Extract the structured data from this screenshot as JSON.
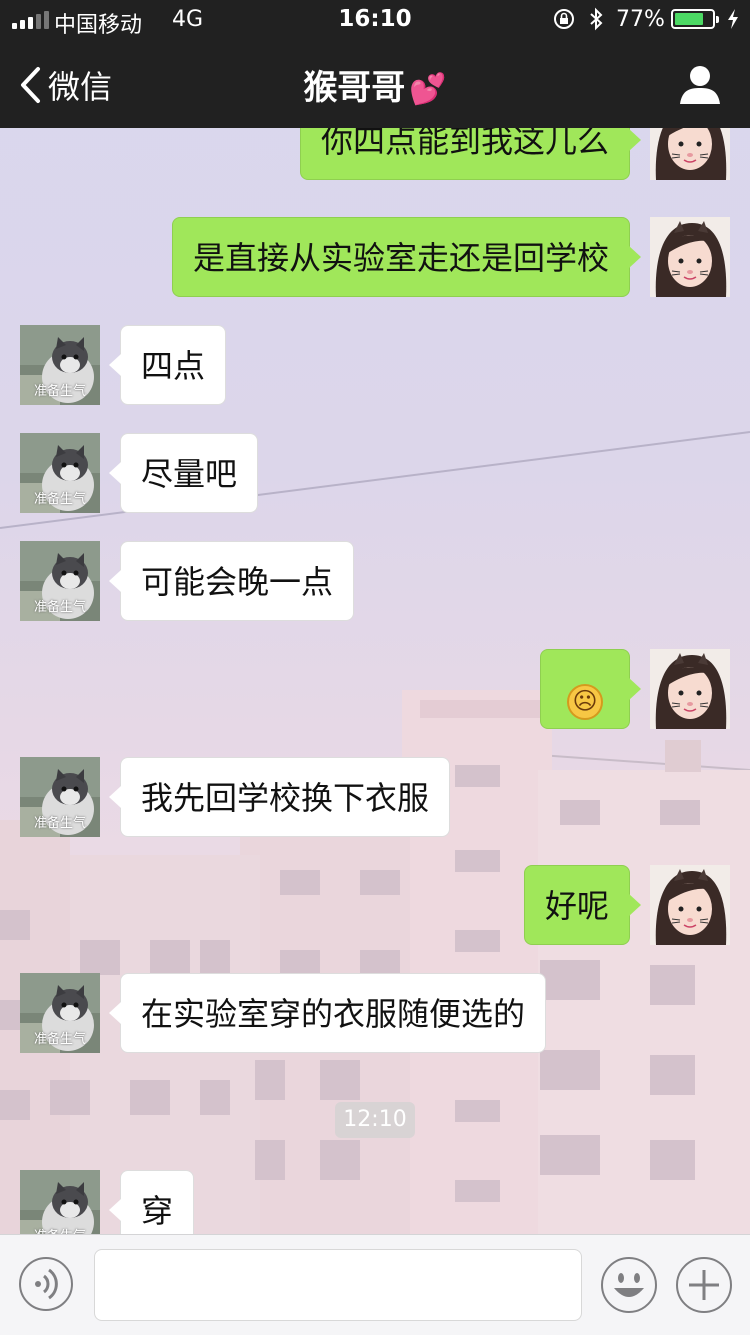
{
  "status_bar": {
    "carrier": "中国移动",
    "network": "4G",
    "time": "16:10",
    "battery_percent": "77%",
    "battery_level": 0.77
  },
  "nav": {
    "back_label": "微信",
    "title": "猴哥哥",
    "title_emoji": "💕"
  },
  "chat": {
    "cat_caption": "准备生气",
    "messages": [
      {
        "from": "me",
        "text": "你四点能到我这儿么"
      },
      {
        "from": "me",
        "text": "是直接从实验室走还是回学校"
      },
      {
        "from": "them",
        "text": "四点"
      },
      {
        "from": "them",
        "text": "尽量吧"
      },
      {
        "from": "them",
        "text": "可能会晚一点"
      },
      {
        "from": "me",
        "text": "☹"
      },
      {
        "from": "them",
        "text": "我先回学校换下衣服"
      },
      {
        "from": "me",
        "text": "好呢"
      },
      {
        "from": "them",
        "text": "在实验室穿的衣服随便选的"
      },
      {
        "from": "them",
        "text": "穿"
      }
    ],
    "timestamp": "12:10"
  },
  "colors": {
    "header_bg": "#212121",
    "my_bubble": "#a0e75a",
    "their_bubble": "#ffffff",
    "battery_fill": "#4cd964"
  },
  "icons": {
    "back": "chevron-left-icon",
    "profile": "person-icon",
    "voice": "voice-icon",
    "emoji": "emoji-icon",
    "more": "plus-icon"
  }
}
